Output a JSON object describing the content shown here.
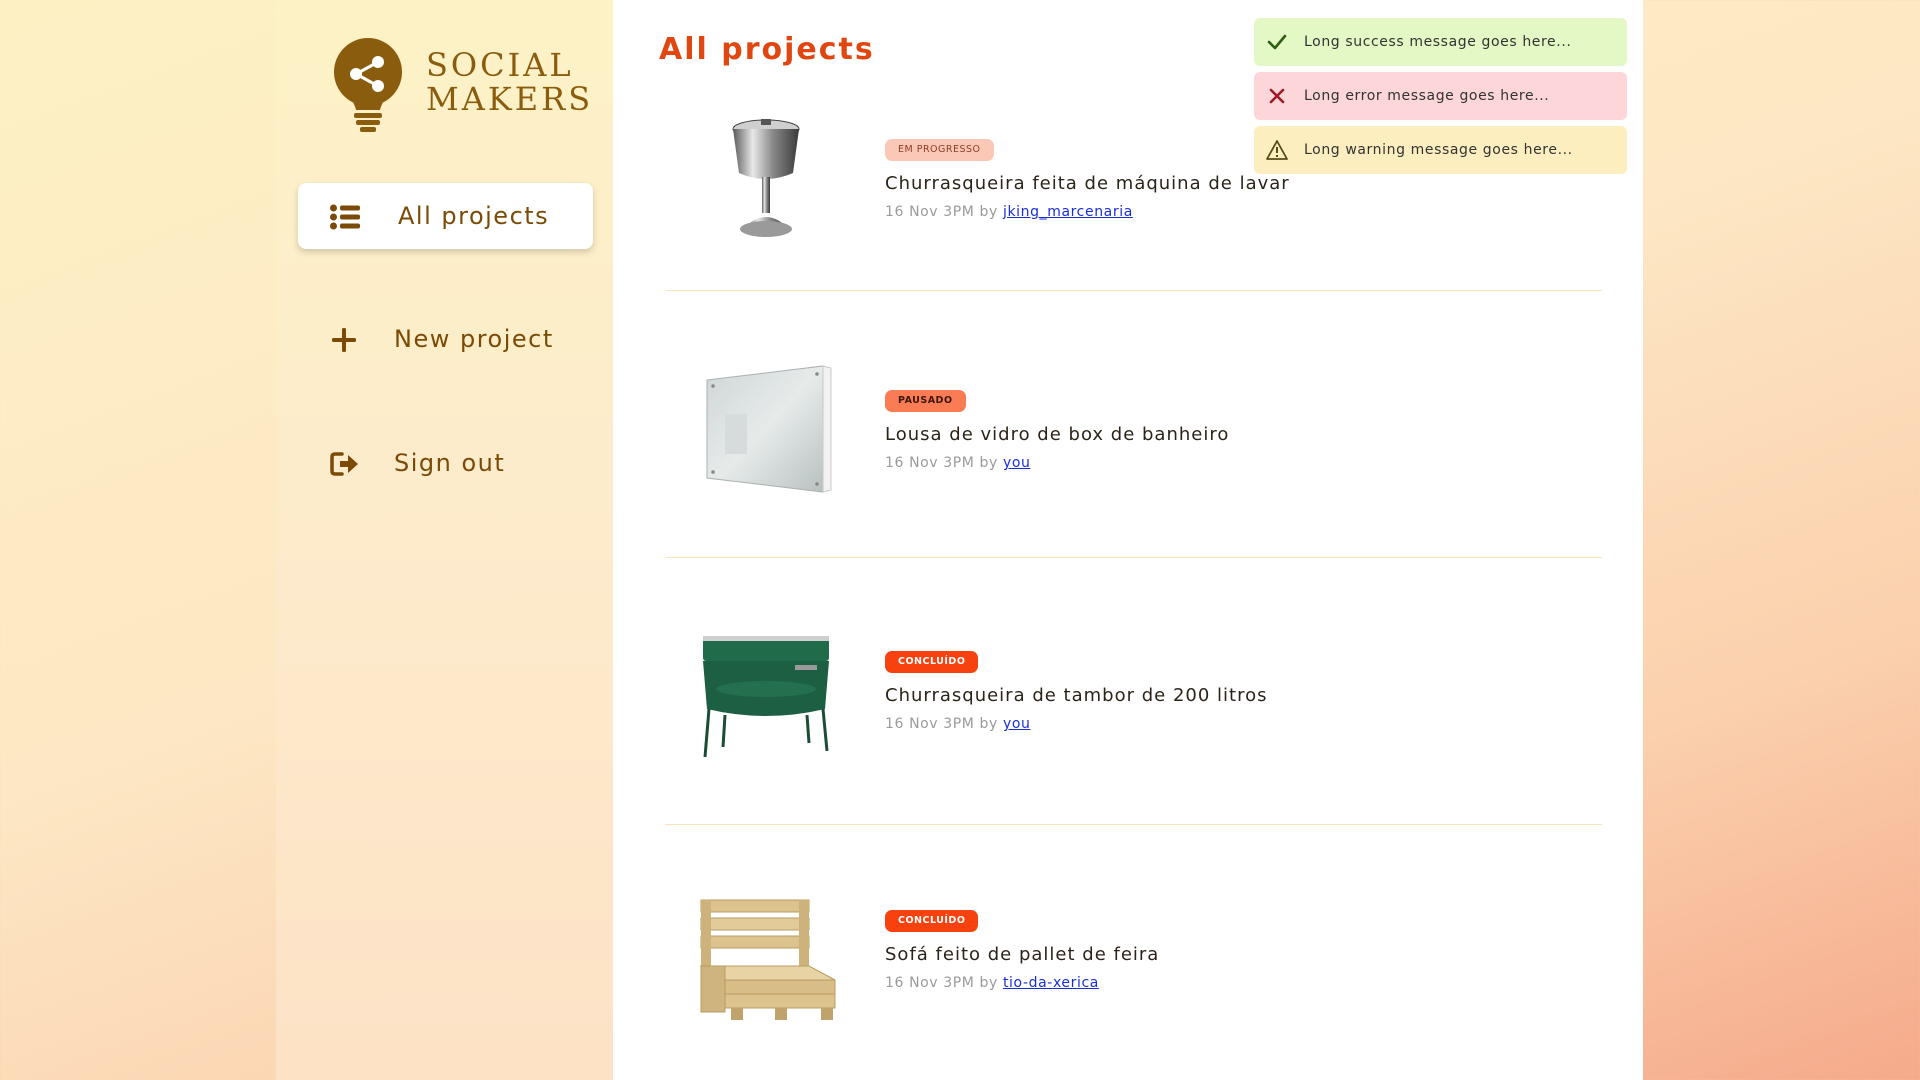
{
  "brand": {
    "line1": "SOCIAL",
    "line2": "MAKERS"
  },
  "colors": {
    "brand": "#8a5c0d",
    "accent": "#e0460f",
    "badge_in_progress": "#fbc8b7",
    "badge_paused": "#f97c55",
    "badge_done": "#f7410f",
    "link": "#1a2ed8"
  },
  "nav": {
    "all_projects": "All projects",
    "new_project": "New project",
    "sign_out": "Sign out"
  },
  "main": {
    "title": "All projects"
  },
  "projects": [
    {
      "status": "EM PROGRESSO",
      "title": "Churrasqueira feita de máquina de lavar",
      "date": "16 Nov 3PM",
      "by": "by",
      "author": "jking_marcenaria",
      "image": "steel-grill-image"
    },
    {
      "status": "PAUSADO",
      "title": "Lousa de vidro de box de banheiro",
      "date": "16 Nov 3PM",
      "by": "by",
      "author": "you",
      "image": "glass-board-image"
    },
    {
      "status": "CONCLUÍDO",
      "title": "Churrasqueira de tambor de 200 litros",
      "date": "16 Nov 3PM",
      "by": "by",
      "author": "you",
      "image": "drum-grill-image"
    },
    {
      "status": "CONCLUÍDO",
      "title": "Sofá feito de pallet de feira",
      "date": "16 Nov 3PM",
      "by": "by",
      "author": "tio-da-xerica",
      "image": "pallet-sofa-image"
    }
  ],
  "toasts": {
    "success": "Long success message goes here...",
    "error": "Long error message goes here...",
    "warning": "Long warning message goes here..."
  }
}
